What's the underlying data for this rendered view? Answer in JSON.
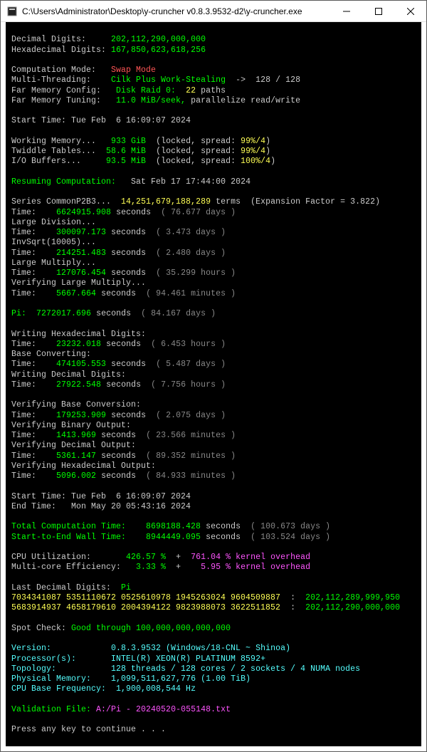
{
  "window": {
    "title": "C:\\Users\\Administrator\\Desktop\\y-cruncher v0.8.3.9532-d2\\y-cruncher.exe"
  },
  "labels": {
    "decimalDigits": "Decimal Digits:",
    "hexDigits": "Hexadecimal Digits:",
    "compMode": "Computation Mode:",
    "multiThread": "Multi-Threading:",
    "farMemCfg": "Far Memory Config:",
    "farMemTune": "Far Memory Tuning:",
    "startTime": "Start Time:",
    "workingMem": "Working Memory...",
    "twiddle": "Twiddle Tables...",
    "ioBuf": "I/O Buffers...",
    "resuming": "Resuming Computation:",
    "series": "Series CommonP2B3...",
    "timeLabel": "Time:",
    "largeDiv": "Large Division...",
    "invSqrt": "InvSqrt(10005)...",
    "largeMul": "Large Multiply...",
    "verLargeMul": "Verifying Large Multiply...",
    "pi": "Pi:",
    "writeHex": "Writing Hexadecimal Digits:",
    "baseConv": "Base Converting:",
    "writeDec": "Writing Decimal Digits:",
    "verBase": "Verifying Base Conversion:",
    "verBin": "Verifying Binary Output:",
    "verDec": "Verifying Decimal Output:",
    "verHex": "Verifying Hexadecimal Output:",
    "endTime": "End Time:",
    "totComp": "Total Computation Time:",
    "wallTime": "Start-to-End Wall Time:",
    "cpuUtil": "CPU Utilization:",
    "mcore": "Multi-core Efficiency:",
    "lastDec": "Last Decimal Digits:",
    "spotCheck": "Spot Check:",
    "version": "Version:",
    "processors": "Processor(s):",
    "topology": "Topology:",
    "physMem": "Physical Memory:",
    "cpuBase": "CPU Base Frequency:",
    "valFile": "Validation File:",
    "pressKey": "Press any key to continue . . .",
    "terms": "terms",
    "expFactor": "(Expansion Factor = 3.822)",
    "kernel": "kernel overhead",
    "seconds": "seconds",
    "paths": "paths",
    "locked": "locked, spread:",
    "cilk": "Cilk Plus Work-Stealing",
    "diskRaid": "Disk Raid 0:",
    "parallelize": "parallelize read/write"
  },
  "values": {
    "decimalDigits": "202,112,290,000,000",
    "hexDigits": "167,850,623,618,256",
    "compMode": "Swap Mode",
    "threads": "128 / 128",
    "raidPaths": "22",
    "memRate": "11.0 MiB/seek,",
    "startTime": "Tue Feb  6 16:09:07 2024",
    "workingMem": "933 GiB",
    "workingMemStat": "99%/4",
    "twiddle": "58.6 MiB",
    "twiddleStat": "99%/4",
    "ioBuf": "93.5 MiB",
    "ioBufStat": "100%/4",
    "resumeTime": "Sat Feb 17 17:44:00 2024",
    "seriesTerms": "14,251,679,188,289",
    "seriesTime": "6624915.908",
    "seriesDays": "( 76.677 days )",
    "largeDivTime": "300097.173",
    "largeDivDays": "( 3.473 days )",
    "invSqrtTime": "214251.483",
    "invSqrtDays": "( 2.480 days )",
    "largeMulTime": "127076.454",
    "largeMulHours": "( 35.299 hours )",
    "verLargeMulTime": "5667.664",
    "verLargeMulMin": "( 94.461 minutes )",
    "piTime": "7272017.696",
    "piDays": "( 84.167 days )",
    "writeHexTime": "23232.018",
    "writeHexHours": "( 6.453 hours )",
    "baseConvTime": "474105.553",
    "baseConvDays": "( 5.487 days )",
    "writeDecTime": "27922.548",
    "writeDecHours": "( 7.756 hours )",
    "verBaseTime": "179253.909",
    "verBaseDays": "( 2.075 days )",
    "verBinTime": "1413.969",
    "verBinMin": "( 23.566 minutes )",
    "verDecTime": "5361.147",
    "verDecMin": "( 89.352 minutes )",
    "verHexTime": "5096.002",
    "verHexMin": "( 84.933 minutes )",
    "endTime": "Mon May 20 05:43:16 2024",
    "totCompTime": "8698188.428",
    "totCompDays": "( 100.673 days )",
    "wallTime": "8944449.095",
    "wallDays": "( 103.524 days )",
    "cpuUtil": "426.57 %",
    "cpuKernel": "761.04 %",
    "mcore": "3.33 %",
    "mcoreKernel": "5.95 %",
    "lastDecPi": "Pi",
    "digitsRow1": "7034341087 5351110672 0525610978 1945263024 9604509887",
    "digitsRow1Idx": "202,112,289,999,950",
    "digitsRow2": "5683914937 4658179610 2004394122 9823988073 3622511852",
    "digitsRow2Idx": "202,112,290,000,000",
    "spotCheck": "Good through 100,000,000,000,000",
    "version": "0.8.3.9532 (Windows/18-CNL ~ Shinoa)",
    "processors": "INTEL(R) XEON(R) PLATINUM 8592+",
    "topology": "128 threads / 128 cores / 2 sockets / 4 NUMA nodes",
    "physMem": "1,099,511,627,776 (1.00 TiB)",
    "cpuBase": "1,900,008,544 Hz",
    "valFile": "A:/Pi - 20240520-055148.txt",
    "arrow": "->"
  }
}
